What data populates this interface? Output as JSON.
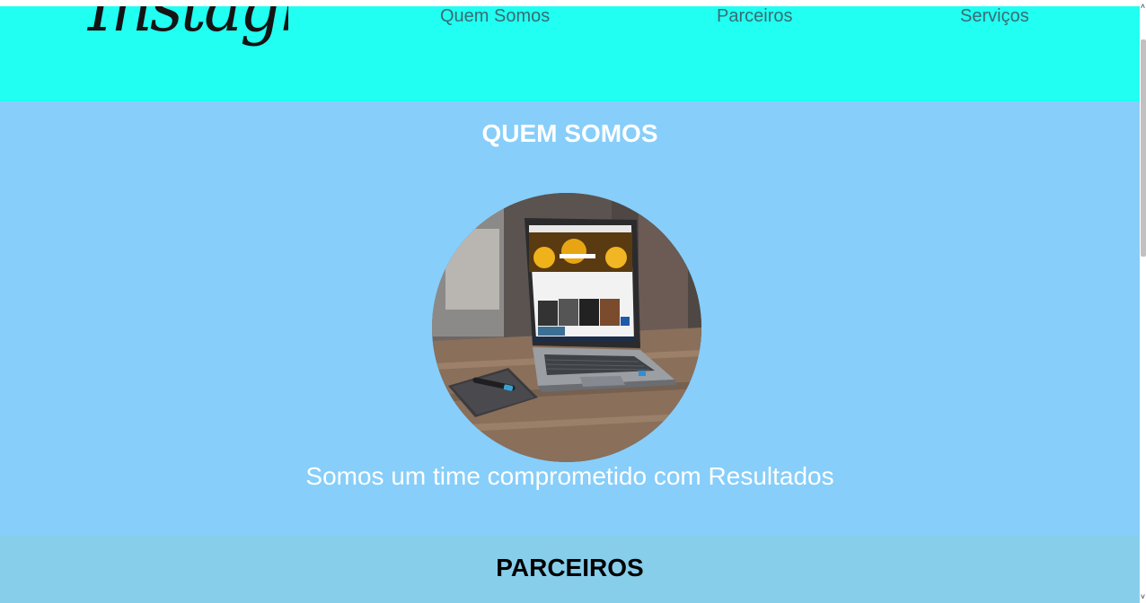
{
  "header": {
    "logo_text": "Instagram",
    "nav": {
      "quem_somos": "Quem Somos",
      "parceiros": "Parceiros",
      "servicos": "Serviços"
    }
  },
  "quem_somos": {
    "title": "QUEM SOMOS",
    "tagline": "Somos um time comprometido com Resultados"
  },
  "parceiros": {
    "title": "PARCEIROS"
  },
  "colors": {
    "header_bg": "#20fff2",
    "quem_bg": "#87cefa",
    "parceiros_bg": "#87ceeb",
    "nav_text": "#3a6b70"
  },
  "icons": {
    "scroll_up": "scroll-up-arrow-icon",
    "scroll_down": "scroll-down-arrow-icon"
  }
}
